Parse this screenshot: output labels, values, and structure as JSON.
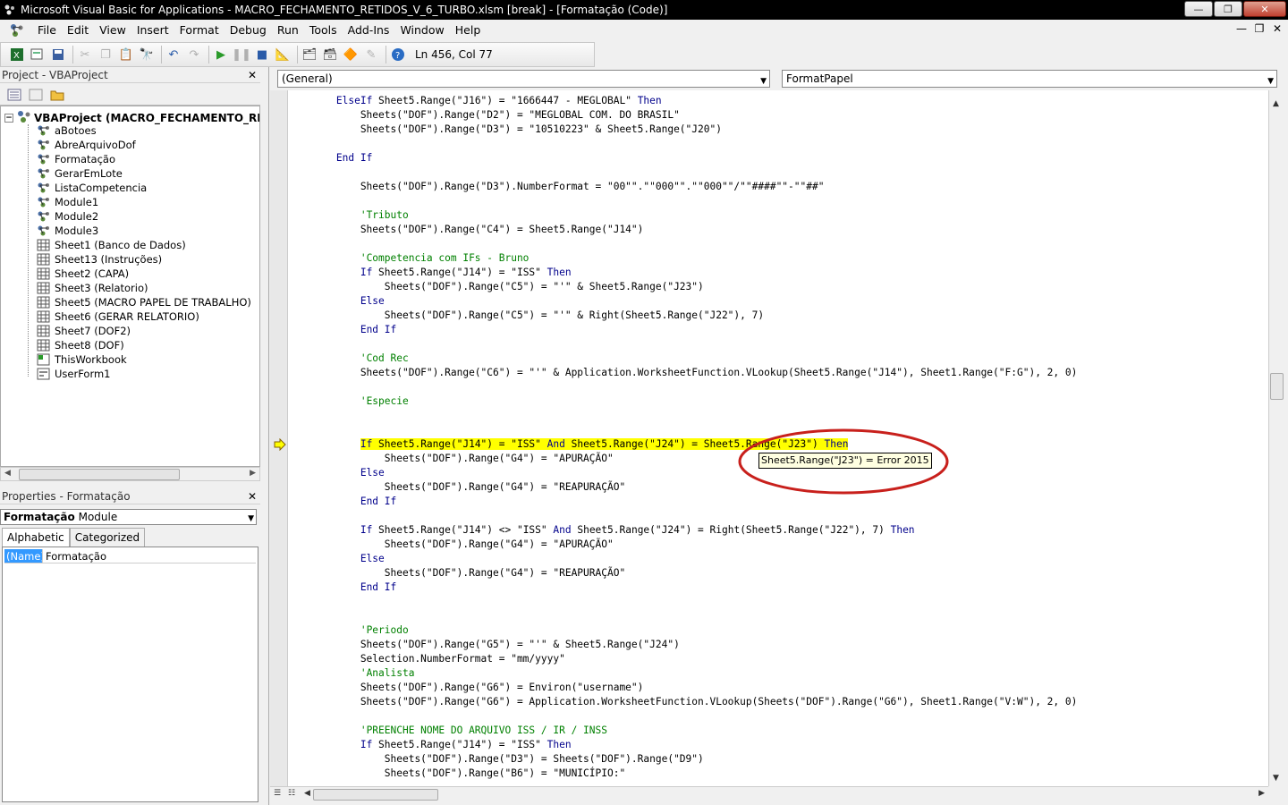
{
  "window": {
    "title": "Microsoft Visual Basic for Applications - MACRO_FECHAMENTO_RETIDOS_V_6_TURBO.xlsm [break] - [Formatação (Code)]",
    "min": "—",
    "restore": "❐",
    "close": "✕"
  },
  "menu": [
    "File",
    "Edit",
    "View",
    "Insert",
    "Format",
    "Debug",
    "Run",
    "Tools",
    "Add-Ins",
    "Window",
    "Help"
  ],
  "mdi": {
    "min": "—",
    "restore": "❐",
    "close": "✕"
  },
  "toolbar": {
    "position": "Ln 456, Col 77"
  },
  "project": {
    "title": "Project - VBAProject",
    "root": "VBAProject (MACRO_FECHAMENTO_RETIDOS",
    "items": [
      {
        "label": "aBotoes",
        "type": "module"
      },
      {
        "label": "AbreArquivoDof",
        "type": "module"
      },
      {
        "label": "Formatação",
        "type": "module"
      },
      {
        "label": "GerarEmLote",
        "type": "module"
      },
      {
        "label": "ListaCompetencia",
        "type": "module"
      },
      {
        "label": "Module1",
        "type": "module"
      },
      {
        "label": "Module2",
        "type": "module"
      },
      {
        "label": "Module3",
        "type": "module"
      },
      {
        "label": "Sheet1 (Banco de Dados)",
        "type": "sheet"
      },
      {
        "label": "Sheet13 (Instruções)",
        "type": "sheet"
      },
      {
        "label": "Sheet2 (CAPA)",
        "type": "sheet"
      },
      {
        "label": "Sheet3 (Relatorio)",
        "type": "sheet"
      },
      {
        "label": "Sheet5 (MACRO PAPEL DE TRABALHO)",
        "type": "sheet"
      },
      {
        "label": "Sheet6 (GERAR RELATORIO)",
        "type": "sheet"
      },
      {
        "label": "Sheet7 (DOF2)",
        "type": "sheet"
      },
      {
        "label": "Sheet8 (DOF)",
        "type": "sheet"
      },
      {
        "label": "ThisWorkbook",
        "type": "workbook"
      },
      {
        "label": "UserForm1",
        "type": "form"
      }
    ]
  },
  "properties": {
    "title": "Properties - Formatação",
    "object_name": "Formatação",
    "object_type": "Module",
    "tabs": [
      "Alphabetic",
      "Categorized"
    ],
    "row_name": "(Name)",
    "row_value": "Formatação"
  },
  "code": {
    "object_combo": "(General)",
    "proc_combo": "FormatPapel",
    "tooltip": "Sheet5.Range(\"J23\") = Error 2015",
    "lines": [
      [
        [
          "",
          "        "
        ],
        [
          "kw",
          "ElseIf"
        ],
        [
          "",
          " Sheet5.Range(\"J16\") = \"1666447 - MEGLOBAL\" "
        ],
        [
          "kw",
          "Then"
        ]
      ],
      [
        [
          "",
          "            Sheets(\"DOF\").Range(\"D2\") = \"MEGLOBAL COM. DO BRASIL\""
        ]
      ],
      [
        [
          "",
          "            Sheets(\"DOF\").Range(\"D3\") = \"10510223\" & Sheet5.Range(\"J20\")"
        ]
      ],
      [],
      [
        [
          "",
          "        "
        ],
        [
          "kw",
          "End If"
        ]
      ],
      [],
      [
        [
          "",
          "            Sheets(\"DOF\").Range(\"D3\").NumberFormat = \"00\"\".\"\"000\"\".\"\"000\"\"/\"\"####\"\"-\"\"##\""
        ]
      ],
      [],
      [
        [
          "",
          "            "
        ],
        [
          "cm",
          "'Tributo"
        ]
      ],
      [
        [
          "",
          "            Sheets(\"DOF\").Range(\"C4\") = Sheet5.Range(\"J14\")"
        ]
      ],
      [],
      [
        [
          "",
          "            "
        ],
        [
          "cm",
          "'Competencia com IFs - Bruno"
        ]
      ],
      [
        [
          "",
          "            "
        ],
        [
          "kw",
          "If"
        ],
        [
          "",
          " Sheet5.Range(\"J14\") = \"ISS\" "
        ],
        [
          "kw",
          "Then"
        ]
      ],
      [
        [
          "",
          "                Sheets(\"DOF\").Range(\"C5\") = \"'\" & Sheet5.Range(\"J23\")"
        ]
      ],
      [
        [
          "",
          "            "
        ],
        [
          "kw",
          "Else"
        ]
      ],
      [
        [
          "",
          "                Sheets(\"DOF\").Range(\"C5\") = \"'\" & Right(Sheet5.Range(\"J22\"), 7)"
        ]
      ],
      [
        [
          "",
          "            "
        ],
        [
          "kw",
          "End If"
        ]
      ],
      [],
      [
        [
          "",
          "            "
        ],
        [
          "cm",
          "'Cod Rec"
        ]
      ],
      [
        [
          "",
          "            Sheets(\"DOF\").Range(\"C6\") = \"'\" & Application.WorksheetFunction.VLookup(Sheet5.Range(\"J14\"), Sheet1.Range(\"F:G\"), 2, 0)"
        ]
      ],
      [],
      [
        [
          "",
          "            "
        ],
        [
          "cm",
          "'Especie"
        ]
      ],
      [],
      [],
      [
        [
          "",
          "            "
        ],
        [
          "hlkw",
          "If"
        ],
        [
          "hl",
          " Sheet5.Range(\"J14\") = \"ISS\" "
        ],
        [
          "hlkw",
          "And"
        ],
        [
          "hl",
          " Sheet5.Range(\"J24\") = Sheet5.Range(\"J23\") "
        ],
        [
          "hlkw",
          "Then"
        ]
      ],
      [
        [
          "",
          "                Sheets(\"DOF\").Range(\"G4\") = \"APURAÇÃO\""
        ]
      ],
      [
        [
          "",
          "            "
        ],
        [
          "kw",
          "Else"
        ]
      ],
      [
        [
          "",
          "                Sheets(\"DOF\").Range(\"G4\") = \"REAPURAÇÃO\""
        ]
      ],
      [
        [
          "",
          "            "
        ],
        [
          "kw",
          "End If"
        ]
      ],
      [],
      [
        [
          "",
          "            "
        ],
        [
          "kw",
          "If"
        ],
        [
          "",
          " Sheet5.Range(\"J14\") <> \"ISS\" "
        ],
        [
          "kw",
          "And"
        ],
        [
          "",
          " Sheet5.Range(\"J24\") = Right(Sheet5.Range(\"J22\"), 7) "
        ],
        [
          "kw",
          "Then"
        ]
      ],
      [
        [
          "",
          "                Sheets(\"DOF\").Range(\"G4\") = \"APURAÇÃO\""
        ]
      ],
      [
        [
          "",
          "            "
        ],
        [
          "kw",
          "Else"
        ]
      ],
      [
        [
          "",
          "                Sheets(\"DOF\").Range(\"G4\") = \"REAPURAÇÃO\""
        ]
      ],
      [
        [
          "",
          "            "
        ],
        [
          "kw",
          "End If"
        ]
      ],
      [],
      [],
      [
        [
          "",
          "            "
        ],
        [
          "cm",
          "'Periodo"
        ]
      ],
      [
        [
          "",
          "            Sheets(\"DOF\").Range(\"G5\") = \"'\" & Sheet5.Range(\"J24\")"
        ]
      ],
      [
        [
          "",
          "            Selection.NumberFormat = \"mm/yyyy\""
        ]
      ],
      [
        [
          "",
          "            "
        ],
        [
          "cm",
          "'Analista"
        ]
      ],
      [
        [
          "",
          "            Sheets(\"DOF\").Range(\"G6\") = Environ(\"username\")"
        ]
      ],
      [
        [
          "",
          "            Sheets(\"DOF\").Range(\"G6\") = Application.WorksheetFunction.VLookup(Sheets(\"DOF\").Range(\"G6\"), Sheet1.Range(\"V:W\"), 2, 0)"
        ]
      ],
      [],
      [
        [
          "",
          "            "
        ],
        [
          "cm",
          "'PREENCHE NOME DO ARQUIVO ISS / IR / INSS"
        ]
      ],
      [
        [
          "",
          "            "
        ],
        [
          "kw",
          "If"
        ],
        [
          "",
          " Sheet5.Range(\"J14\") = \"ISS\" "
        ],
        [
          "kw",
          "Then"
        ]
      ],
      [
        [
          "",
          "                Sheets(\"DOF\").Range(\"D3\") = Sheets(\"DOF\").Range(\"D9\")"
        ]
      ],
      [
        [
          "",
          "                Sheets(\"DOF\").Range(\"B6\") = \"MUNICÍPIO:\""
        ]
      ]
    ]
  }
}
